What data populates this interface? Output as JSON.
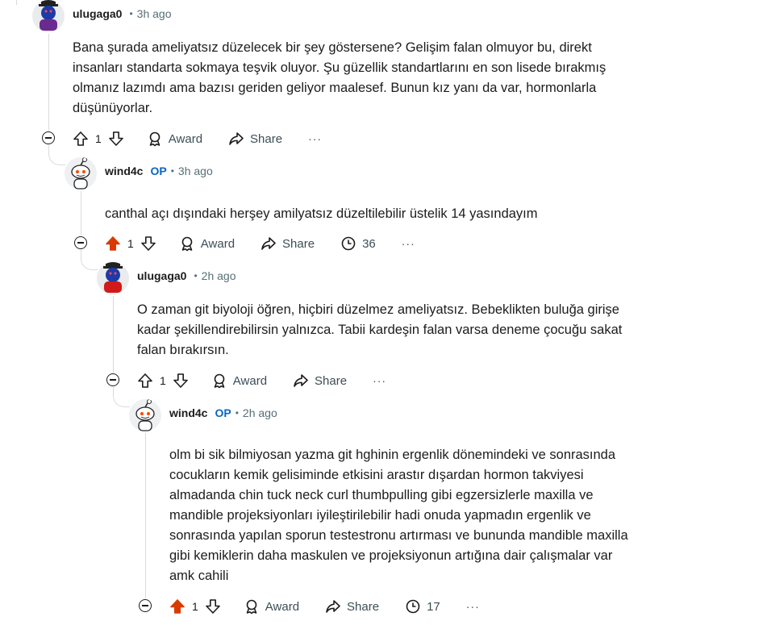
{
  "comments": [
    {
      "username": "ulugaga0",
      "op_badge": "",
      "time": "3h ago",
      "body": "Bana şurada ameliyatsız düzelecek bir şey göstersene? Gelişim falan olmuyor bu, direkt insanları standarta sokmaya teşvik oluyor. Şu güzellik standartlarını en son lisede bırakmış olmanız lazımdı ama bazısı geriden geliyor maalesef. Bunun kız yanı da var, hormonlarla düşünüyorlar.",
      "score": "1",
      "upvoted": false,
      "award_label": "Award",
      "share_label": "Share",
      "awards_count": "",
      "more": "···"
    },
    {
      "username": "wind4c",
      "op_badge": "OP",
      "time": "3h ago",
      "body": "canthal açı dışındaki herşey amilyatsız düzeltilebilir üstelik 14 yasındayım",
      "score": "1",
      "upvoted": true,
      "award_label": "Award",
      "share_label": "Share",
      "awards_count": "36",
      "more": "···"
    },
    {
      "username": "ulugaga0",
      "op_badge": "",
      "time": "2h ago",
      "body": "O zaman git biyoloji öğren, hiçbiri düzelmez ameliyatsız. Bebeklikten buluğa girişe kadar şekillendirebilirsin yalnızca. Tabii kardeşin falan varsa deneme çocuğu sakat falan bırakırsın.",
      "score": "1",
      "upvoted": false,
      "award_label": "Award",
      "share_label": "Share",
      "awards_count": "",
      "more": "···"
    },
    {
      "username": "wind4c",
      "op_badge": "OP",
      "time": "2h ago",
      "body": "olm bi sik bilmiyosan yazma git hghinin ergenlik dönemindeki ve sonrasında cocukların kemik gelisiminde etkisini arastır dışardan hormon takviyesi almadanda chin tuck neck curl thumbpulling gibi egzersizlerle maxilla ve mandible projeksiyonları iyileştirilebilir hadi onuda yapmadın ergenlik ve sonrasında yapılan sporun testestronu artırması ve bununda mandible maxilla gibi kemiklerin daha maskulen ve projeksiyonun artığına dair çalışmalar var amk cahili",
      "score": "1",
      "upvoted": true,
      "award_label": "Award",
      "share_label": "Share",
      "awards_count": "17",
      "more": "···"
    }
  ],
  "colors": {
    "upvote_active": "#d93a00",
    "op_badge": "#0a66c2",
    "meta_gray": "#576f76",
    "thread_line": "#dadada"
  },
  "icons": {
    "collapse": "minus-circle-icon",
    "upvote": "upvote-arrow-icon",
    "downvote": "downvote-arrow-icon",
    "award": "award-icon",
    "share": "share-arrow-icon",
    "awards_count": "award-timer-icon",
    "more": "ellipsis-icon"
  }
}
